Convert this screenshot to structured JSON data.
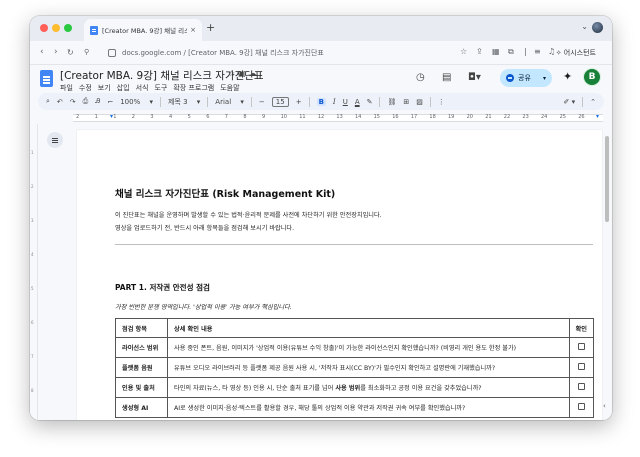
{
  "browser": {
    "tab_title": "[Creator MBA. 9강] 채널 리스",
    "tab_close": "×",
    "new_tab": "+",
    "tab_menu": "⌄",
    "url": "docs.google.com / [Creator MBA. 9강] 채널 리스크 자가진단표",
    "assistant_label": "어시스턴트"
  },
  "docs": {
    "title": "[Creator MBA. 9강] 채널 리스크 자가진단표",
    "menus": [
      "파일",
      "수정",
      "보기",
      "삽입",
      "서식",
      "도구",
      "확장 프로그램",
      "도움말"
    ],
    "share_label": "공유",
    "avatar_letter": "B"
  },
  "toolbar": {
    "zoom": "100%",
    "style": "제목 3",
    "font": "Arial",
    "font_size": "15",
    "bold": "B",
    "italic": "I",
    "underline": "U",
    "text_color": "A"
  },
  "ruler": {
    "ticks": [
      "2",
      "1",
      "1",
      "2",
      "3",
      "4",
      "5",
      "6",
      "7",
      "8",
      "9",
      "10",
      "11",
      "12",
      "13",
      "14",
      "15",
      "16",
      "17",
      "18",
      "19",
      "20",
      "21",
      "22",
      "23",
      "24",
      "25",
      "26"
    ]
  },
  "document": {
    "heading": "채널 리스크 자가진단표 (Risk Management Kit)",
    "intro_line1": "이 진단표는 채널을 운영하며 발생할 수 있는 법적·윤리적 문제를 사전에 차단하기 위한 안전장치입니다.",
    "intro_line2": "영상을 업로드하기 전, 반드시 아래 항목들을 점검해 보시기 바랍니다.",
    "part1_title": "PART 1. 저작권 안전성 점검",
    "part1_sub": "가장 빈번한 분쟁 영역입니다. '상업적 이용' 가능 여부가 핵심입니다.",
    "table": {
      "headers": [
        "점검 항목",
        "상세 확인 내용",
        "확인"
      ],
      "rows": [
        {
          "item": "라이선스 범위",
          "detail": "사용 중인 폰트, 음원, 이미지가 '상업적 이용(유튜브 수익 창출)'이 가능한 라이선스인지 확인했습니까? (비영리 개인 용도 한정 불가)"
        },
        {
          "item": "플랫폼 음원",
          "detail": "유튜브 오디오 라이브러리 등 플랫폼 제공 음원 사용 시, '저작자 표시(CC BY)'가 필수인지 확인하고 설명란에 기재했습니까?"
        },
        {
          "item": "인용 및 출처",
          "detail_pre": "타인의 자료(뉴스, 타 영상 등) 인용 시, 단순 출처 표기를 넘어 ",
          "detail_bold": "사용 범위",
          "detail_post": "를 최소화하고 공정 이용 요건을 갖추었습니까?"
        },
        {
          "item": "생성형 AI",
          "detail": "AI로 생성한 이미지·음성·텍스트를 활용할 경우, 해당 툴의 상업적 이용 약관과 저작권 귀속 여부를 확인했습니까?"
        }
      ]
    }
  }
}
